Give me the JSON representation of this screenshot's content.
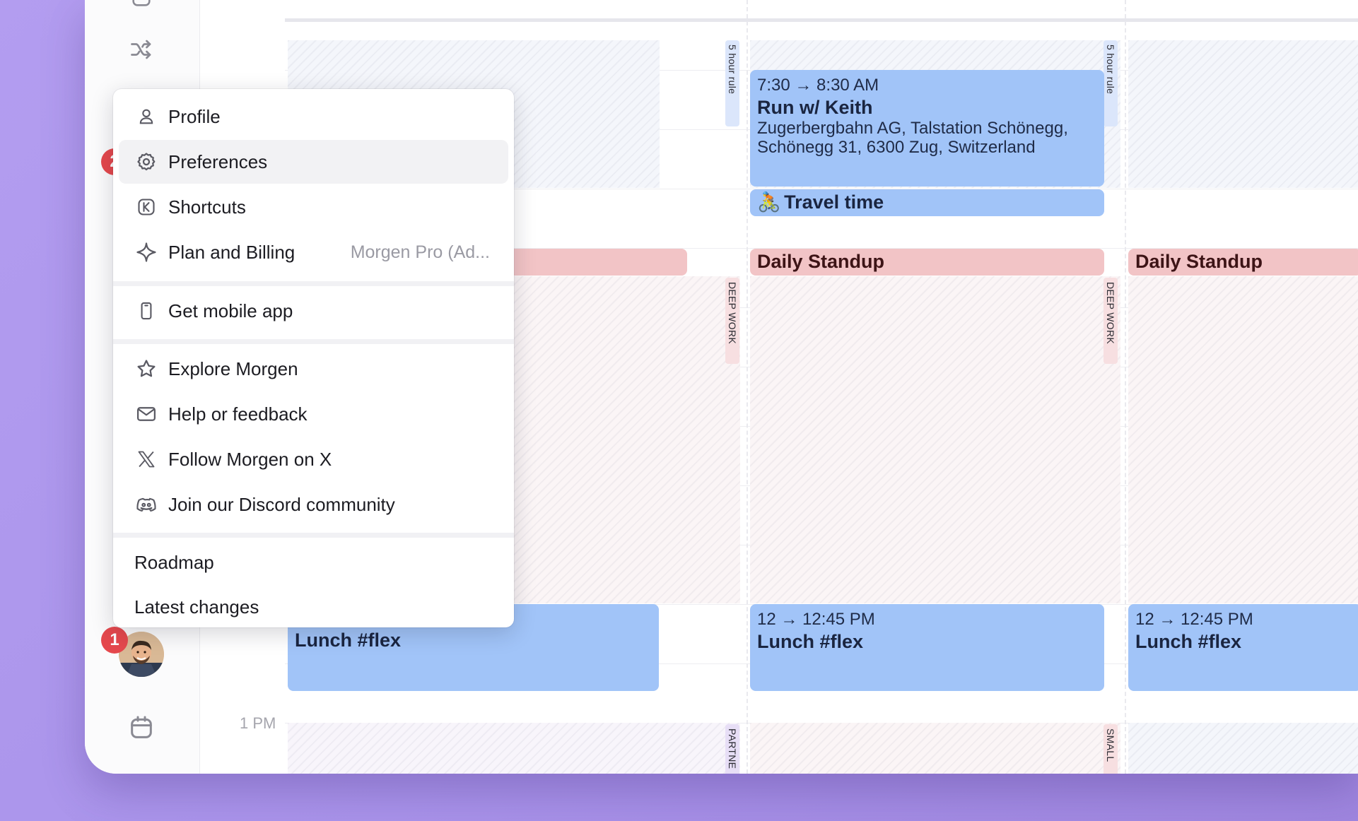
{
  "calendar": {
    "time_label_1pm": "1 PM",
    "tags": {
      "five_hour_rule": "5 hour rule",
      "deep_work": "DEEP WORK",
      "partner": "PARTNE",
      "small": "SMALL"
    },
    "events": {
      "run": {
        "time": "7:30 → 8:30 AM",
        "title": "Run w/ Keith",
        "location": "Zugerbergbahn AG, Talstation Schönegg, Schönegg 31, 6300 Zug, Switzerland"
      },
      "travel": {
        "emoji": "🚴",
        "title": "Travel time"
      },
      "standup": {
        "title": "Daily Standup"
      },
      "lunch": {
        "time": "12 → 12:45 PM",
        "title": "Lunch #flex"
      }
    }
  },
  "menu": {
    "items": [
      {
        "label": "Profile",
        "icon": "person-icon"
      },
      {
        "label": "Preferences",
        "icon": "gear-icon"
      },
      {
        "label": "Shortcuts",
        "icon": "keyboard-k-icon"
      },
      {
        "label": "Plan and Billing",
        "sub": "Morgen Pro (Ad...",
        "icon": "sparkle-icon"
      },
      {
        "label": "Get mobile app",
        "icon": "phone-icon"
      },
      {
        "label": "Explore Morgen",
        "icon": "star-icon"
      },
      {
        "label": "Help or feedback",
        "icon": "mail-icon"
      },
      {
        "label": "Follow Morgen on X",
        "icon": "x-logo-icon"
      },
      {
        "label": "Join our Discord community",
        "icon": "discord-icon"
      },
      {
        "label": "Roadmap"
      },
      {
        "label": "Latest changes"
      }
    ]
  },
  "badges": {
    "step1": "1",
    "step2": "2"
  },
  "colors": {
    "accent_blue": "#a1c4f8",
    "standup_pink": "#f2c4c6",
    "badge_red": "#e5484d",
    "background_purple": "#b39df0"
  }
}
